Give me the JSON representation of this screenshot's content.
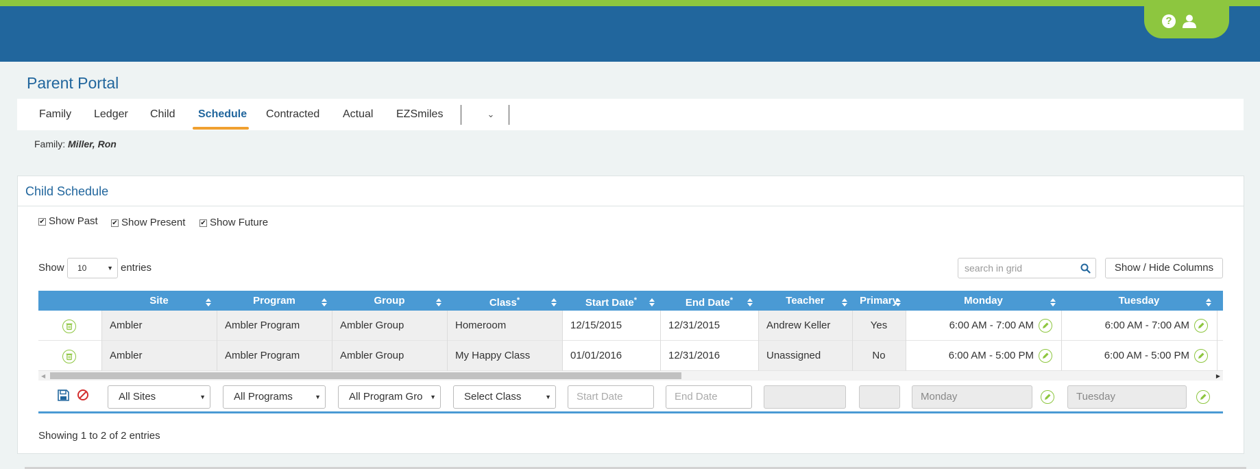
{
  "header": {
    "help_icon_glyph": "?",
    "accent": "#8dc63f",
    "primary": "#21669d"
  },
  "page_title": "Parent Portal",
  "tabs": [
    {
      "label": "Family"
    },
    {
      "label": "Ledger"
    },
    {
      "label": "Child"
    },
    {
      "label": "Schedule",
      "active": true
    },
    {
      "label": "Contracted"
    },
    {
      "label": "Actual"
    },
    {
      "label": "EZSmiles"
    }
  ],
  "family": {
    "label": "Family:",
    "name": "Miller, Ron"
  },
  "panel": {
    "title": "Child Schedule",
    "filters": [
      {
        "label": "Show Past",
        "checked": true
      },
      {
        "label": "Show Present",
        "checked": true
      },
      {
        "label": "Show Future",
        "checked": true
      }
    ],
    "length_menu": {
      "show": "Show",
      "value": "10",
      "entries": "entries"
    },
    "search": {
      "placeholder": "search in grid"
    },
    "show_hide_label": "Show / Hide Columns",
    "columns": [
      "Site",
      "Program",
      "Group",
      "Class",
      "Start Date",
      "End Date",
      "Teacher",
      "Primary",
      "Monday",
      "Tuesday"
    ],
    "required_mark": "*",
    "rows": [
      {
        "site": "Ambler",
        "program": "Ambler Program",
        "group": "Ambler Group",
        "class": "Homeroom",
        "start": "12/15/2015",
        "end": "12/31/2015",
        "teacher": "Andrew Keller",
        "primary": "Yes",
        "monday": "6:00 AM - 7:00 AM",
        "tuesday": "6:00 AM - 7:00 AM"
      },
      {
        "site": "Ambler",
        "program": "Ambler Program",
        "group": "Ambler Group",
        "class": "My Happy Class",
        "start": "01/01/2016",
        "end": "12/31/2016",
        "teacher": "Unassigned",
        "primary": "No",
        "monday": "6:00 AM - 5:00 PM",
        "tuesday": "6:00 AM - 5:00 PM"
      }
    ],
    "new_row": {
      "site": "All Sites",
      "program": "All Programs",
      "group": "All Program Gro",
      "class": "Select Class",
      "start_placeholder": "Start Date",
      "end_placeholder": "End Date",
      "monday_placeholder": "Monday",
      "tuesday_placeholder": "Tuesday"
    },
    "footer": "Showing 1 to 2 of 2 entries"
  }
}
